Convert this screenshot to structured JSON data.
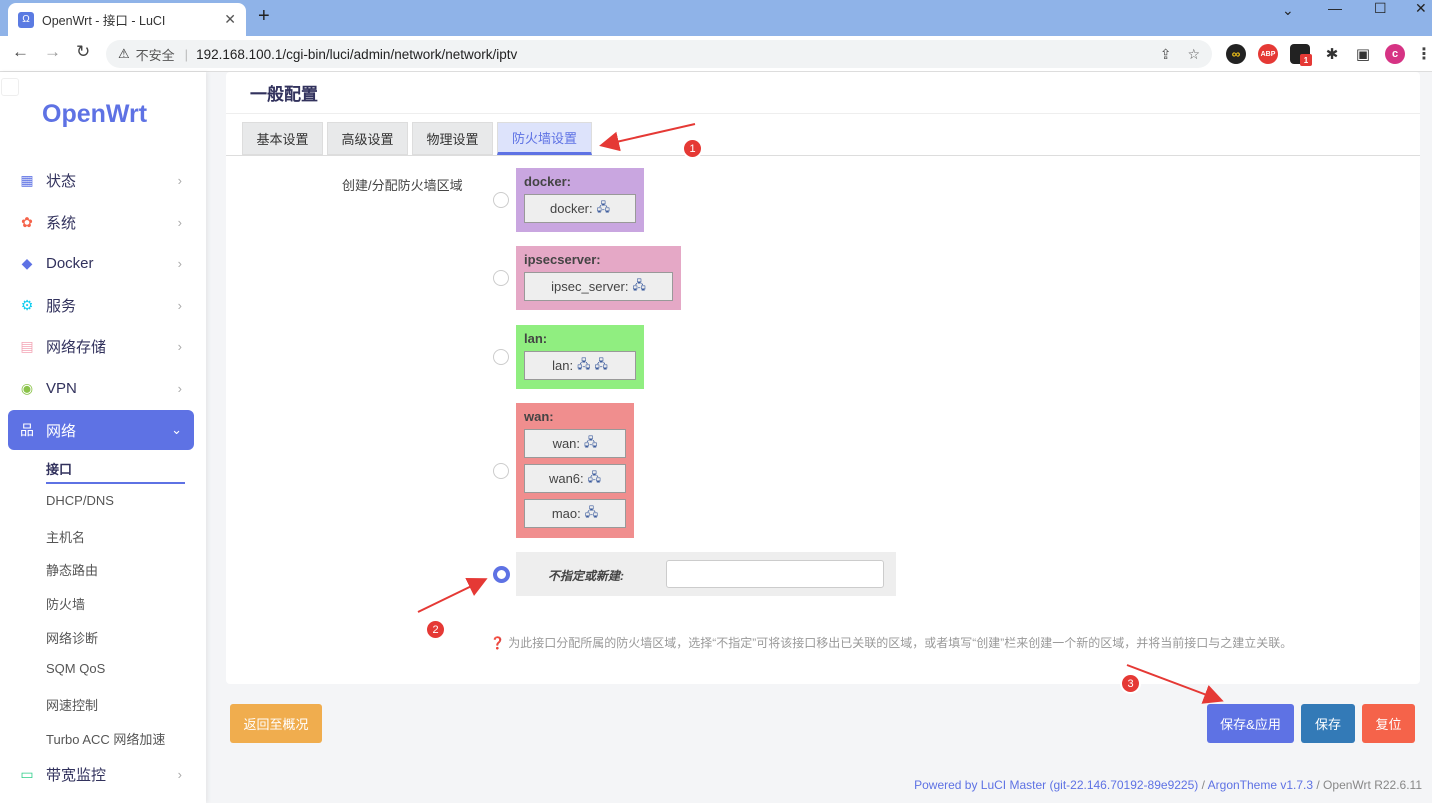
{
  "browser": {
    "tab_title": "OpenWrt - 接口 - LuCI",
    "tab_favicon": "Ω",
    "insecure_label": "不安全",
    "url": "192.168.100.1/cgi-bin/luci/admin/network/network/iptv",
    "extensions": [
      "infinity-icon",
      "abp-icon",
      "notification-icon",
      "puzzle-icon",
      "sidepanel-icon",
      "profile-icon"
    ],
    "abp_label": "ABP",
    "notif_badge": "1",
    "profile_initial": "c"
  },
  "sidebar": {
    "logo": "OpenWrt",
    "items": [
      {
        "label": "状态",
        "icon": "dashboard-icon"
      },
      {
        "label": "系统",
        "icon": "gear-icon"
      },
      {
        "label": "Docker",
        "icon": "docker-icon"
      },
      {
        "label": "服务",
        "icon": "services-icon"
      },
      {
        "label": "网络存储",
        "icon": "storage-icon"
      },
      {
        "label": "VPN",
        "icon": "vpn-icon"
      },
      {
        "label": "网络",
        "icon": "network-icon"
      },
      {
        "label": "带宽监控",
        "icon": "monitor-icon"
      }
    ],
    "submenu": [
      "接口",
      "DHCP/DNS",
      "主机名",
      "静态路由",
      "防火墙",
      "网络诊断",
      "SQM QoS",
      "网速控制",
      "Turbo ACC 网络加速"
    ]
  },
  "main": {
    "section_title": "一般配置",
    "tabs": [
      "基本设置",
      "高级设置",
      "物理设置",
      "防火墙设置"
    ],
    "field_label": "创建/分配防火墙区域",
    "zones": [
      {
        "name": "docker:",
        "interfaces": [
          "docker:"
        ],
        "color": "#c9a6e0"
      },
      {
        "name": "ipsecserver:",
        "interfaces": [
          "ipsec_server:"
        ],
        "color": "#e5a8c6"
      },
      {
        "name": "lan:",
        "interfaces": [
          "lan:"
        ],
        "color": "#90ee80"
      },
      {
        "name": "wan:",
        "interfaces": [
          "wan:",
          "wan6:",
          "mao:"
        ],
        "color": "#f08e8e"
      }
    ],
    "new_zone_label": "不指定或新建:",
    "new_zone_value": "",
    "help_text": "为此接口分配所属的防火墙区域，选择“不指定”可将该接口移出已关联的区域，或者填写“创建”栏来创建一个新的区域，并将当前接口与之建立关联。"
  },
  "buttons": {
    "back": "返回至概况",
    "save_apply": "保存&应用",
    "save": "保存",
    "reset": "复位"
  },
  "colors": {
    "accent": "#5e72e4",
    "back": "#f0ad4e",
    "save": "#337ab7",
    "reset": "#f5634a"
  },
  "footer": {
    "powered": "Powered by LuCI Master (git-22.146.70192-89e9225)",
    "slash": "/",
    "theme": "ArgonTheme v1.7.3",
    "version": "/ OpenWrt R22.6.11"
  },
  "annotations": [
    "1",
    "2",
    "3"
  ]
}
